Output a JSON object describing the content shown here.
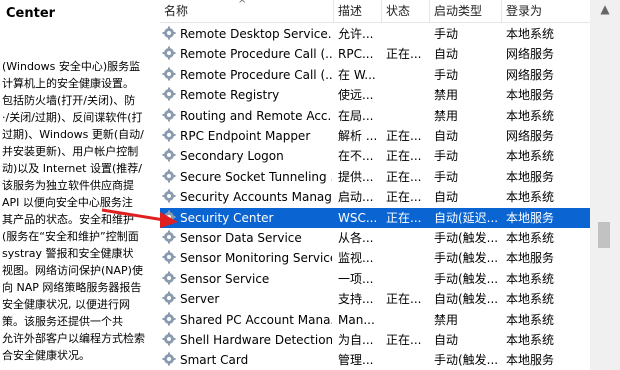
{
  "description": {
    "title": "Center",
    "text": "(Windows 安全中心)服务监\n计算机上的安全健康设置。\n包括防火墙(打开/关闭)、防\n·/关闭/过期)、反间谍软件(打\n过期)、Windows 更新(自动/\n并安装更新)、用户帐户控制\n动)以及 Internet 设置(推荐/\n该服务为独立软件供应商提\nAPI 以便向安全中心服务注\n其产品的状态。安全和维护\n(服务在“安全和维护”控制面\nsystray 警报和安全健康状\n视图。网络访问保护(NAP)使\n向 NAP 网络策略服务器报告\n安全健康状况, 以便进行网\n策。该服务还提供一个共\n允许外部客户以编程方式检索\n合安全健康状况。"
  },
  "columns": {
    "name": "名称",
    "desc": "描述",
    "status": "状态",
    "startup": "启动类型",
    "login": "登录为"
  },
  "services": [
    {
      "name": "Remote Desktop Service...",
      "desc": "允许...",
      "status": "",
      "startup": "手动",
      "login": "本地系统"
    },
    {
      "name": "Remote Procedure Call (...",
      "desc": "RPC...",
      "status": "正在...",
      "startup": "自动",
      "login": "网络服务"
    },
    {
      "name": "Remote Procedure Call (...",
      "desc": "在 W...",
      "status": "",
      "startup": "手动",
      "login": "网络服务"
    },
    {
      "name": "Remote Registry",
      "desc": "使远...",
      "status": "",
      "startup": "禁用",
      "login": "本地服务"
    },
    {
      "name": "Routing and Remote Acc...",
      "desc": "在局...",
      "status": "",
      "startup": "禁用",
      "login": "本地系统"
    },
    {
      "name": "RPC Endpoint Mapper",
      "desc": "解析 ...",
      "status": "正在...",
      "startup": "自动",
      "login": "网络服务"
    },
    {
      "name": "Secondary Logon",
      "desc": "在不...",
      "status": "正在...",
      "startup": "手动",
      "login": "本地系统"
    },
    {
      "name": "Secure Socket Tunneling ...",
      "desc": "提供...",
      "status": "正在...",
      "startup": "手动",
      "login": "本地服务"
    },
    {
      "name": "Security Accounts Manag...",
      "desc": "启动...",
      "status": "正在...",
      "startup": "自动",
      "login": "本地系统"
    },
    {
      "name": "Security Center",
      "desc": "WSC...",
      "status": "正在...",
      "startup": "自动(延迟...",
      "login": "本地服务"
    },
    {
      "name": "Sensor Data Service",
      "desc": "从各...",
      "status": "",
      "startup": "手动(触发...",
      "login": "本地系统"
    },
    {
      "name": "Sensor Monitoring Service",
      "desc": "监视...",
      "status": "",
      "startup": "手动(触发...",
      "login": "本地服务"
    },
    {
      "name": "Sensor Service",
      "desc": "一项...",
      "status": "",
      "startup": "手动(触发...",
      "login": "本地系统"
    },
    {
      "name": "Server",
      "desc": "支持...",
      "status": "正在...",
      "startup": "自动(触发...",
      "login": "本地系统"
    },
    {
      "name": "Shared PC Account Mana...",
      "desc": "Man...",
      "status": "",
      "startup": "禁用",
      "login": "本地系统"
    },
    {
      "name": "Shell Hardware Detection",
      "desc": "为自...",
      "status": "正在...",
      "startup": "自动",
      "login": "本地系统"
    },
    {
      "name": "Smart Card",
      "desc": "管理...",
      "status": "",
      "startup": "手动(触发...",
      "login": "本地服务"
    }
  ],
  "selected_index": 9,
  "colors": {
    "selection": "#0a64d2",
    "annotation_arrow": "#e02020"
  }
}
